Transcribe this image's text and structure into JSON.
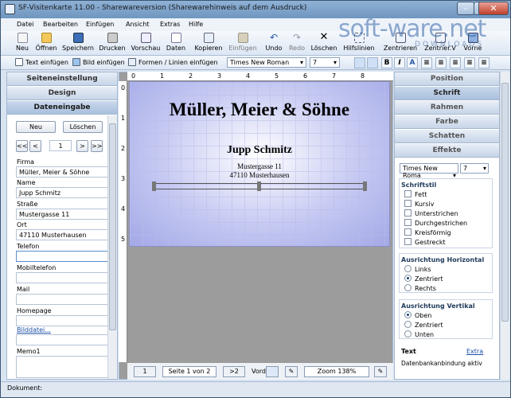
{
  "window": {
    "title": "SF-Visitenkarte 11.00 - Sharewareversion (Sharewarehinweis auf dem Ausdruck)"
  },
  "watermark": {
    "text": "soft-ware.net",
    "sub": "DOWNLOADS"
  },
  "menu": [
    "Datei",
    "Bearbeiten",
    "Einfügen",
    "Ansicht",
    "Extras",
    "Hilfe"
  ],
  "toolbar": {
    "neu": "Neu",
    "oeffnen": "Öffnen",
    "speichern": "Speichern",
    "drucken": "Drucken",
    "vorschau": "Vorschau",
    "daten": "Daten",
    "kopieren": "Kopieren",
    "einfuegen": "Einfügen",
    "undo": "Undo",
    "redo": "Redo",
    "loeschen": "Löschen",
    "hilfslinien": "Hilfslinien",
    "zentrieren": "Zentrieren",
    "zentrieren_v": "Zentrier.V",
    "vorne": "Vorne"
  },
  "toolbar2": {
    "text_einfuegen": "Text einfügen",
    "bild_einfuegen": "Bild einfügen",
    "formen": "Formen / Linien einfügen",
    "font": "Times New Roman",
    "size": "7",
    "bold": "B",
    "italic": "I",
    "color": "A"
  },
  "left": {
    "tabs": [
      "Seiteneinstellung",
      "Design",
      "Dateneingabe"
    ],
    "neu": "Neu",
    "loeschen": "Löschen",
    "nav_first": "<<",
    "nav_prev": "<",
    "nav_index": "1",
    "nav_next": ">",
    "nav_last": ">>",
    "fields": [
      {
        "label": "Firma",
        "value": "Müller, Meier & Söhne"
      },
      {
        "label": "Name",
        "value": "Jupp Schmitz"
      },
      {
        "label": "Straße",
        "value": "Mustergasse 11"
      },
      {
        "label": "Ort",
        "value": "47110 Musterhausen"
      },
      {
        "label": "Telefon",
        "value": ""
      },
      {
        "label": "Mobiltelefon",
        "value": ""
      },
      {
        "label": "Mail",
        "value": ""
      },
      {
        "label": "Homepage",
        "value": ""
      }
    ],
    "bilddatei": "Bilddatei...",
    "memo_label": "Memo1"
  },
  "card": {
    "company": "Müller, Meier & Söhne",
    "name": "Jupp Schmitz",
    "street": "Mustergasse 11",
    "city": "47110 Musterhausen"
  },
  "ruler_h": [
    "0",
    "1",
    "2",
    "3",
    "4",
    "5",
    "6",
    "7",
    "8"
  ],
  "ruler_v": [
    "0",
    "1",
    "2",
    "3",
    "4",
    "5"
  ],
  "status": {
    "page_btn": "1",
    "page_info": "Seite 1 von 2",
    "next_btn": ">2",
    "vord": "Vord",
    "zoom": "Zoom 138%"
  },
  "right": {
    "tabs": [
      "Position",
      "Schrift",
      "Rahmen",
      "Farbe",
      "Schatten",
      "Effekte"
    ],
    "font": "Times New Roma",
    "size": "7",
    "schriftstil_title": "Schriftstil",
    "styles": [
      "Fett",
      "Kursiv",
      "Unterstrichen",
      "Durchgestrichen",
      "Kreisförmig",
      "Gestreckt"
    ],
    "horiz_title": "Ausrichtung Horizontal",
    "horiz": [
      "Links",
      "Zentriert",
      "Rechts"
    ],
    "vert_title": "Ausrichtung Vertikal",
    "vert": [
      "Oben",
      "Zentriert",
      "Unten"
    ],
    "text_label": "Text",
    "extra_link": "Extra",
    "db_label": "Datenbankanbindung aktiv"
  },
  "statusline": {
    "text": "Dokument:"
  }
}
